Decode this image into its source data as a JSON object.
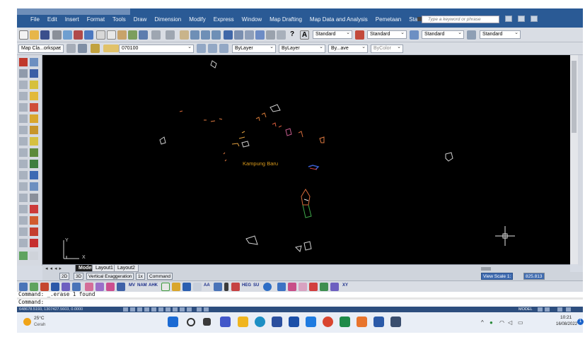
{
  "menu": {
    "items": [
      "File",
      "Edit",
      "Insert",
      "Format",
      "Tools",
      "Draw",
      "Dimension",
      "Modify",
      "Express",
      "Window",
      "Map Drafting",
      "Map Data and Analysis",
      "Pemetaan",
      "Standarisasi"
    ],
    "search_placeholder": "Type a keyword or phrase"
  },
  "toolbar": {
    "styles": [
      "Standard",
      "Standard",
      "Standard",
      "Standard"
    ],
    "workspace": "Map Cla...orkspac",
    "layer": "070100",
    "color": "ByLayer",
    "linetype": "ByLayer",
    "lineweight": "By...ave",
    "plotstyle": "ByColor"
  },
  "canvas": {
    "place_label": "Kampung Baru",
    "ucs_y": "Y",
    "ucs_x": "X"
  },
  "layout_tabs": [
    "Model",
    "Layout1",
    "Layout2"
  ],
  "status3d": {
    "mode_2d": "2D",
    "mode_3d": "3D",
    "vertical_exag": "Vertical Exaggeration",
    "exag_value": "1x",
    "command_btn": "Command",
    "view_scale": "View Scale 1:",
    "scale_value": "825.813"
  },
  "bottom_toolbar": {
    "labels": [
      "MV",
      "NAM",
      "AHK",
      "AA",
      "HEG",
      "SU",
      "XY"
    ]
  },
  "command": {
    "history": "Command: _.erase 1 found",
    "prompt": "Command:"
  },
  "statusbar": {
    "coords": "648678.5193, 1307427.5603, 0.0000",
    "model": "MODEL"
  },
  "taskbar": {
    "temp": "25°C",
    "condition": "Cerah",
    "time": "10:21",
    "date": "16/08/2022",
    "notifications": "1"
  },
  "colors": {
    "menubar": "#2a5a95",
    "canvas": "#000000",
    "label": "#d99a1c",
    "statusbar": "#2d4e7e"
  }
}
